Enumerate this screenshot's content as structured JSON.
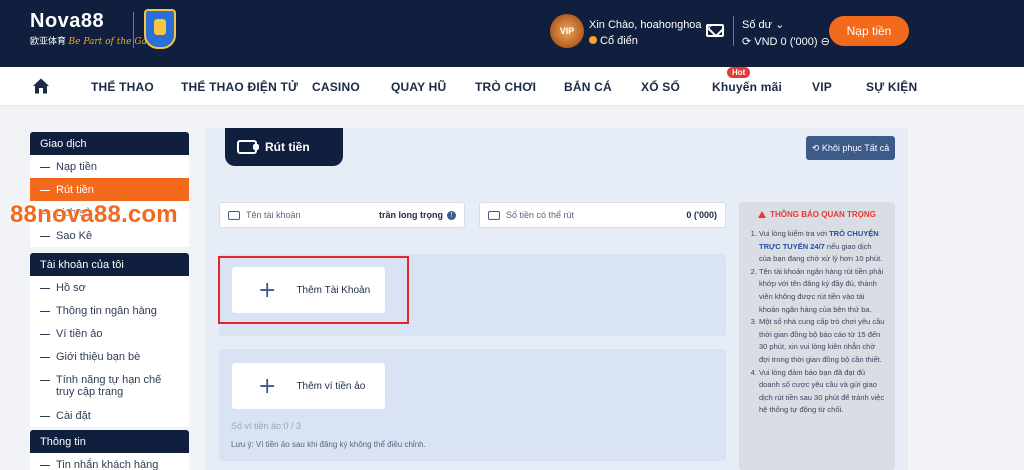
{
  "header": {
    "brand": "Nova88",
    "brand_sub_cn": "欧亚体育",
    "brand_sub_slogan": "Be Part of the Game!",
    "vip_label": "VIP",
    "greeting": "Xin Chào, hoahonghoa",
    "level": "Cổ điển",
    "balance_label": "Số dư",
    "balance_value": "VND 0 ('000)",
    "deposit_button": "Nạp tiền"
  },
  "nav": {
    "items": [
      "THỂ THAO",
      "THỂ THAO ĐIỆN TỬ",
      "CASINO",
      "QUAY HŨ",
      "TRÒ CHƠI",
      "BẮN CÁ",
      "XỔ SỐ",
      "Khuyến mãi",
      "VIP",
      "SỰ KIỆN"
    ],
    "hot_badge": "Hot"
  },
  "watermark": "88nova88.com",
  "sidebar": {
    "groups": [
      {
        "title": "Giao dịch",
        "items": [
          "Nạp tiền",
          "Rút tiền",
          "Lịch sử",
          "Sao Kê"
        ]
      },
      {
        "title": "Tài khoản của tôi",
        "items": [
          "Hồ sơ",
          "Thông tin ngân hàng",
          "Ví tiền ảo",
          "Giới thiệu bạn bè",
          "Tính năng tự hạn chế truy cập trang",
          "Cài đặt"
        ]
      },
      {
        "title": "Thông tin",
        "items": [
          "Tin nhắn khách hàng"
        ]
      }
    ]
  },
  "main": {
    "title": "Rút tiền",
    "restore_button": "Khôi phục Tất cả",
    "account_name_label": "Tên tài khoản",
    "account_name_value": "trần long trọng",
    "withdrawable_label": "Số tiền có thể rút",
    "withdrawable_value": "0 ('000)",
    "add_account": "Thêm Tài Khoản",
    "add_wallet": "Thêm ví tiền ảo",
    "wallet_count": "Số ví tiền ảo:0 / 3",
    "wallet_note": "Lưu ý: Ví tiền ảo sau khi đăng ký không thể điều chỉnh."
  },
  "notice": {
    "title": "THÔNG BÁO QUAN TRỌNG",
    "item1_pre": "Vui lòng kiểm tra với",
    "item1_link": "TRÒ CHUYỆN TRỰC TUYẾN 24/7",
    "item1_post": "nếu giao dịch của bạn đang chờ xử lý hơn 10 phút.",
    "item2": "Tên tài khoản ngân hàng rút tiền phải khớp với tên đăng ký đầy đủ, thành viên không được rút tiền vào tài khoản ngân hàng của bên thứ ba.",
    "item3": "Một số nhà cung cấp trò chơi yêu cầu thời gian đồng bộ bảo cáo từ 15 đến 30 phút, xin vui lòng kiên nhẫn chờ đợi trong thời gian đồng bộ cần thiết.",
    "item4": "Vui lòng đảm bảo bạn đã đạt đủ doanh số cược yêu cầu và gửi giao dịch rút tiền sau 30 phút để tránh việc hệ thống tự động từ chối."
  },
  "colors": {
    "header_bg": "#0f1f3d",
    "accent": "#f36a1d",
    "highlight": "#e5262b"
  }
}
